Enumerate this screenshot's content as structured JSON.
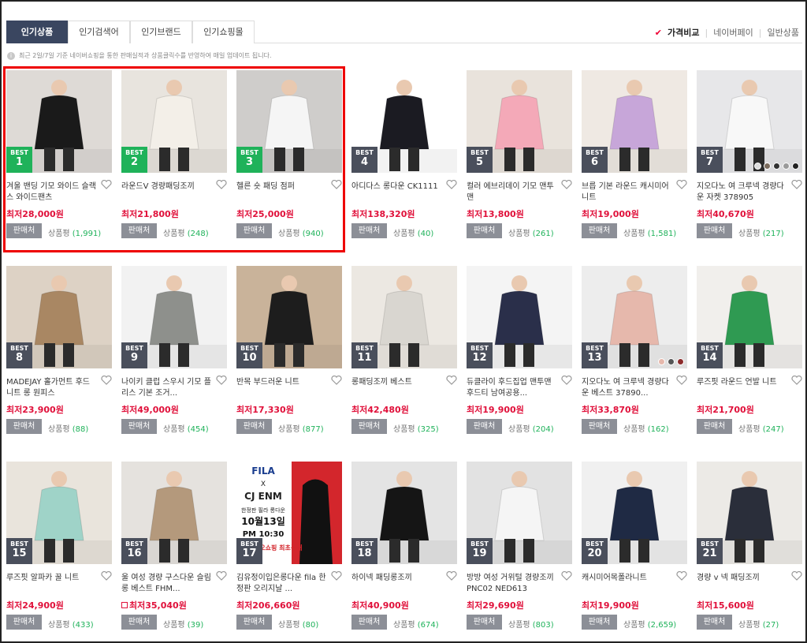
{
  "tabs": [
    "인기상품",
    "인기검색어",
    "인기브랜드",
    "인기쇼핑몰"
  ],
  "sorts": {
    "active": "가격비교",
    "others": [
      "네이버페이",
      "일반상품"
    ]
  },
  "notice": "최근 2일/7일 기준 네이버쇼핑을 통한 판매실적과 상품클릭수를 반영하여 매일 업데이트 됩니다.",
  "labels": {
    "best": "BEST",
    "seller": "판매처",
    "review": "상품평"
  },
  "colors": {
    "top_badge": "#1fb25a",
    "badge": "#4a4f5c",
    "price": "#e0103a",
    "highlight": "#e00000"
  },
  "products": [
    {
      "rank": "1",
      "title": "겨울 밴딩 기모 와이드 슬랙스 와이드팬츠",
      "price": "최저28,000원",
      "reviews": "(1,991)",
      "bg": "#dedad6",
      "fg": "#1a1a1a"
    },
    {
      "rank": "2",
      "title": "라운드V 경량패딩조끼",
      "price": "최저21,800원",
      "reviews": "(248)",
      "bg": "#e8e4de",
      "fg": "#f3efe8"
    },
    {
      "rank": "3",
      "title": "헬른 숏 패딩 점퍼",
      "price": "최저25,000원",
      "reviews": "(940)",
      "bg": "#cfcdcb",
      "fg": "#f5f5f5"
    },
    {
      "rank": "4",
      "title": "아디다스 롱다운 CK1111",
      "price": "최저138,320원",
      "reviews": "(40)",
      "bg": "#ffffff",
      "fg": "#1b1b22"
    },
    {
      "rank": "5",
      "title": "컬러 에브리데이 기모 맨투맨",
      "price": "최저13,800원",
      "reviews": "(261)",
      "bg": "#e9e3dc",
      "fg": "#f4a9b8"
    },
    {
      "rank": "6",
      "title": "브릅 기본 라운드 캐시미어 니트",
      "price": "최저19,000원",
      "reviews": "(1,581)",
      "bg": "#efe9e3",
      "fg": "#c7a6d9"
    },
    {
      "rank": "7",
      "title": "지오다노 여 크루넥 경량다운 자켓 378905",
      "price": "최저40,670원",
      "reviews": "(217)",
      "bg": "#e7e7e9",
      "fg": "#f8f8f8"
    },
    {
      "rank": "8",
      "title": "MADEJAY 홀가먼트 후드 니트 롱 원피스",
      "price": "최저23,900원",
      "reviews": "(88)",
      "bg": "#ddd2c5",
      "fg": "#a98763"
    },
    {
      "rank": "9",
      "title": "나이키 클럽 스우시 기모 플리스 기본 조거...",
      "price": "최저49,000원",
      "reviews": "(454)",
      "bg": "#f2f2f2",
      "fg": "#8e908c"
    },
    {
      "rank": "10",
      "title": "반목 부드러운 니트",
      "price": "최저17,330원",
      "reviews": "(877)",
      "bg": "#c9b39a",
      "fg": "#1d1d1d"
    },
    {
      "rank": "11",
      "title": "롱패딩조끼 베스트",
      "price": "최저42,480원",
      "reviews": "(325)",
      "bg": "#ece8e2",
      "fg": "#d9d6d0"
    },
    {
      "rank": "12",
      "title": "듀클라이 후드집업 맨투맨 후드티 남여공용...",
      "price": "최저19,900원",
      "reviews": "(204)",
      "bg": "#f4f4f4",
      "fg": "#2a2f4a"
    },
    {
      "rank": "13",
      "title": "지오다노 여 크루넥 경량다운 베스트 37890...",
      "price": "최저33,870원",
      "reviews": "(162)",
      "bg": "#ededed",
      "fg": "#e6b8ac"
    },
    {
      "rank": "14",
      "title": "루즈핏 라운드 언발 니트",
      "price": "최저21,700원",
      "reviews": "(247)",
      "bg": "#f1efec",
      "fg": "#2f9a52"
    },
    {
      "rank": "15",
      "title": "루즈핏 알파카 꿀 니트",
      "price": "최저24,900원",
      "reviews": "(433)",
      "bg": "#e9e4dc",
      "fg": "#9fd3c8"
    },
    {
      "rank": "16",
      "title": "울 여성 경량 구스다운 슬림 롱 베스트 FHM...",
      "price": "최저35,040원",
      "reviews": "(39)",
      "bg": "#e5e2de",
      "fg": "#b4997c",
      "npay": true
    },
    {
      "rank": "17",
      "title": "김유정이입은롱다운 fila 한정판 오리지날 ...",
      "price": "최저206,660원",
      "reviews": "(80)",
      "bg": "#ffffff",
      "fg": "#d3262c",
      "poster": {
        "brand": "FILA",
        "x": "X",
        "partner": "CJ ENM",
        "line1": "한정판 필라 롱다운",
        "date": "10월13일",
        "time": "PM 10:30",
        "tag": "CJ오쇼핑 최초공개"
      }
    },
    {
      "rank": "18",
      "title": "하이넥 패딩롱조끼",
      "price": "최저40,900원",
      "reviews": "(674)",
      "bg": "#e4e4e4",
      "fg": "#151515"
    },
    {
      "rank": "19",
      "title": "방방 여성 거위털 경량조끼 PNC02 NED613",
      "price": "최저29,690원",
      "reviews": "(803)",
      "bg": "#e2e2e2",
      "fg": "#f5f5f5"
    },
    {
      "rank": "20",
      "title": "캐시미어목폴라니트",
      "price": "최저19,900원",
      "reviews": "(2,659)",
      "bg": "#f0f0f0",
      "fg": "#1f2a44"
    },
    {
      "rank": "21",
      "title": "경량 v 넥 패딩조끼",
      "price": "최저15,600원",
      "reviews": "(27)",
      "bg": "#eceae6",
      "fg": "#2a2e3a"
    }
  ]
}
